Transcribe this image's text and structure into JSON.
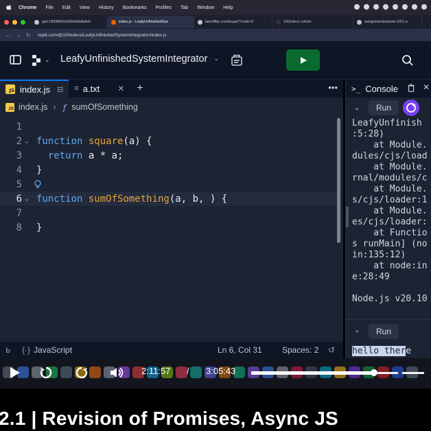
{
  "menubar": {
    "items": [
      "Chrome",
      "File",
      "Edit",
      "View",
      "History",
      "Bookmarks",
      "Profiles",
      "Tab",
      "Window",
      "Help"
    ]
  },
  "browser": {
    "tabs": [
      {
        "label": "gist:1809806cb30e5dbdfafe0"
      },
      {
        "label": "index.js - LeafyUnfinishedSys",
        "active": true
      },
      {
        "label": "latentflip.com/loupe/?code=Z"
      },
      {
        "label": "100xdevs cohort"
      },
      {
        "label": "assignments/week-2/01-a"
      }
    ],
    "url": "replit.com/@100xdevs/LeafyUnfinishedSystemIntegrator#index.js"
  },
  "replit": {
    "project_name": "LeafyUnfinishedSystemIntegrator",
    "tabs": [
      {
        "label": "index.js",
        "active": true
      },
      {
        "label": "a.txt"
      }
    ],
    "breadcrumb": {
      "file": "index.js",
      "symbol": "sumOfSomething"
    },
    "code_lines": [
      {
        "num": "1",
        "tokens": []
      },
      {
        "num": "2",
        "fold": true,
        "tokens": [
          [
            "kw",
            "function "
          ],
          [
            "fnn",
            "square"
          ],
          [
            "var",
            "(a) {"
          ]
        ]
      },
      {
        "num": "3",
        "tokens": [
          [
            "var",
            "  "
          ],
          [
            "kw",
            "return "
          ],
          [
            "var",
            "a * a;"
          ]
        ]
      },
      {
        "num": "4",
        "tokens": [
          [
            "var",
            "}"
          ]
        ]
      },
      {
        "num": "5",
        "bulb": true,
        "tokens": []
      },
      {
        "num": "6",
        "fold": true,
        "current": true,
        "tokens": [
          [
            "kw",
            "function "
          ],
          [
            "fnn",
            "sumOfSomething"
          ],
          [
            "var",
            "(a, b, ) {"
          ]
        ]
      },
      {
        "num": "7",
        "tokens": []
      },
      {
        "num": "8",
        "tokens": [
          [
            "var",
            "}"
          ]
        ]
      }
    ],
    "status": {
      "language": "JavaScript",
      "position": "Ln 6, Col 31",
      "spaces": "Spaces: 2"
    },
    "console": {
      "title": "Console",
      "run_label": "Run",
      "output": "LeafyUnfinish\n:5:28)\n    at Module.\ndules/cjs/load\n    at Module.\nrnal/modules/c\n    at Module.\ns/cjs/loader:1\n    at Module.\nes/cjs/loader:\n    at Functio\ns runMain] (no\nin:135:12)\n    at node:in\ne:28:49\n\nNode.js v20.10",
      "run_label_2": "Run",
      "typed_selected": "hello ther",
      "typed_rest": "e"
    }
  },
  "player": {
    "current_time": "2:11:57",
    "separator": "/",
    "duration": "3:05:43",
    "progress_fraction": 0.71
  },
  "caption": {
    "title": "2.1 | Revision of Promises, Async JS"
  },
  "colors": {
    "accent_blue": "#0079f2",
    "run_green": "#0b6b2f",
    "keyword": "#5fa8f0",
    "function_name": "#e8a33d"
  }
}
